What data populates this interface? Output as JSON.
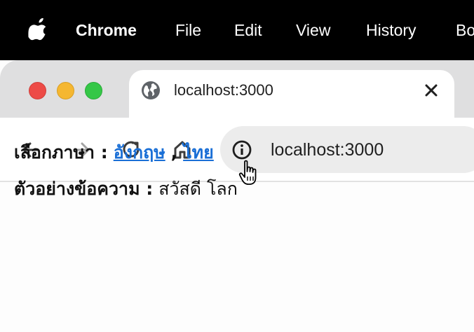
{
  "menubar": {
    "items": [
      "Chrome",
      "File",
      "Edit",
      "View",
      "History",
      "Bo"
    ]
  },
  "browser": {
    "tab_title": "localhost:3000",
    "url": "localhost:3000"
  },
  "page": {
    "language_label": "เลือกภาษา :",
    "lang_english": "อังกฤษ",
    "separator": ",",
    "lang_thai": "ไทย",
    "sample_label": "ตัวอย่างข้อความ :",
    "sample_text": "สวัสดี โลก"
  },
  "colors": {
    "link": "#1a6fd6",
    "menubar_bg": "#000000",
    "tabstrip_bg": "#dfdfe0",
    "omnibox_bg": "#ececec"
  }
}
